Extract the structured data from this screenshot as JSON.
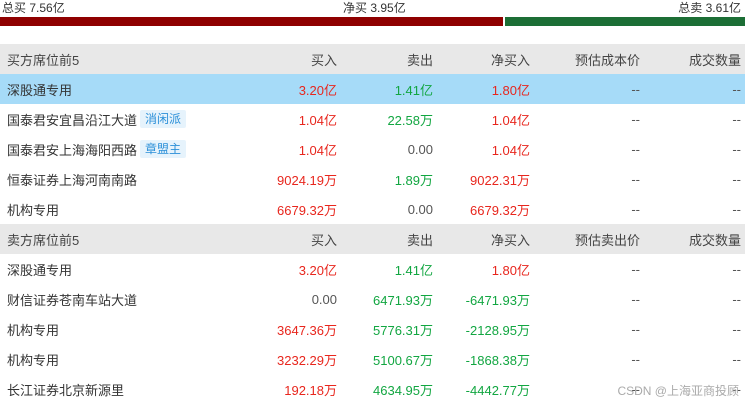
{
  "summary": {
    "total_buy": "总买 7.56亿",
    "net_buy": "净买 3.95亿",
    "total_sell": "总卖 3.61亿",
    "buy_fraction": 0.677,
    "sell_fraction": 0.323,
    "colors": {
      "buy": "#8f0000",
      "sell": "#1c6e35"
    }
  },
  "buy_section": {
    "headers": [
      "买方席位前5",
      "买入",
      "卖出",
      "净买入",
      "预估成本价",
      "成交数量"
    ],
    "rows": [
      {
        "name": "深股通专用",
        "tag": "",
        "buy": "3.20亿",
        "sell": "1.41亿",
        "net": "1.80亿",
        "est": "--",
        "qty": "--"
      },
      {
        "name": "国泰君安宜昌沿江大道",
        "tag": "消闲派",
        "buy": "1.04亿",
        "sell": "22.58万",
        "net": "1.04亿",
        "est": "--",
        "qty": "--"
      },
      {
        "name": "国泰君安上海海阳西路",
        "tag": "章盟主",
        "buy": "1.04亿",
        "sell": "0.00",
        "net": "1.04亿",
        "est": "--",
        "qty": "--"
      },
      {
        "name": "恒泰证券上海河南南路",
        "tag": "",
        "buy": "9024.19万",
        "sell": "1.89万",
        "net": "9022.31万",
        "est": "--",
        "qty": "--"
      },
      {
        "name": "机构专用",
        "tag": "",
        "buy": "6679.32万",
        "sell": "0.00",
        "net": "6679.32万",
        "est": "--",
        "qty": "--"
      }
    ]
  },
  "sell_section": {
    "headers": [
      "卖方席位前5",
      "买入",
      "卖出",
      "净买入",
      "预估卖出价",
      "成交数量"
    ],
    "rows": [
      {
        "name": "深股通专用",
        "buy": "3.20亿",
        "sell": "1.41亿",
        "net": "1.80亿",
        "est": "--",
        "qty": "--"
      },
      {
        "name": "财信证券苍南车站大道",
        "buy": "0.00",
        "sell": "6471.93万",
        "net": "-6471.93万",
        "est": "--",
        "qty": "--"
      },
      {
        "name": "机构专用",
        "buy": "3647.36万",
        "sell": "5776.31万",
        "net": "-2128.95万",
        "est": "--",
        "qty": "--"
      },
      {
        "name": "机构专用",
        "buy": "3232.29万",
        "sell": "5100.67万",
        "net": "-1868.38万",
        "est": "--",
        "qty": "--"
      },
      {
        "name": "长江证券北京新源里",
        "buy": "192.18万",
        "sell": "4634.95万",
        "net": "-4442.77万",
        "est": "--",
        "qty": "--"
      }
    ]
  },
  "watermark": "CSDN @上海亚商投顾"
}
